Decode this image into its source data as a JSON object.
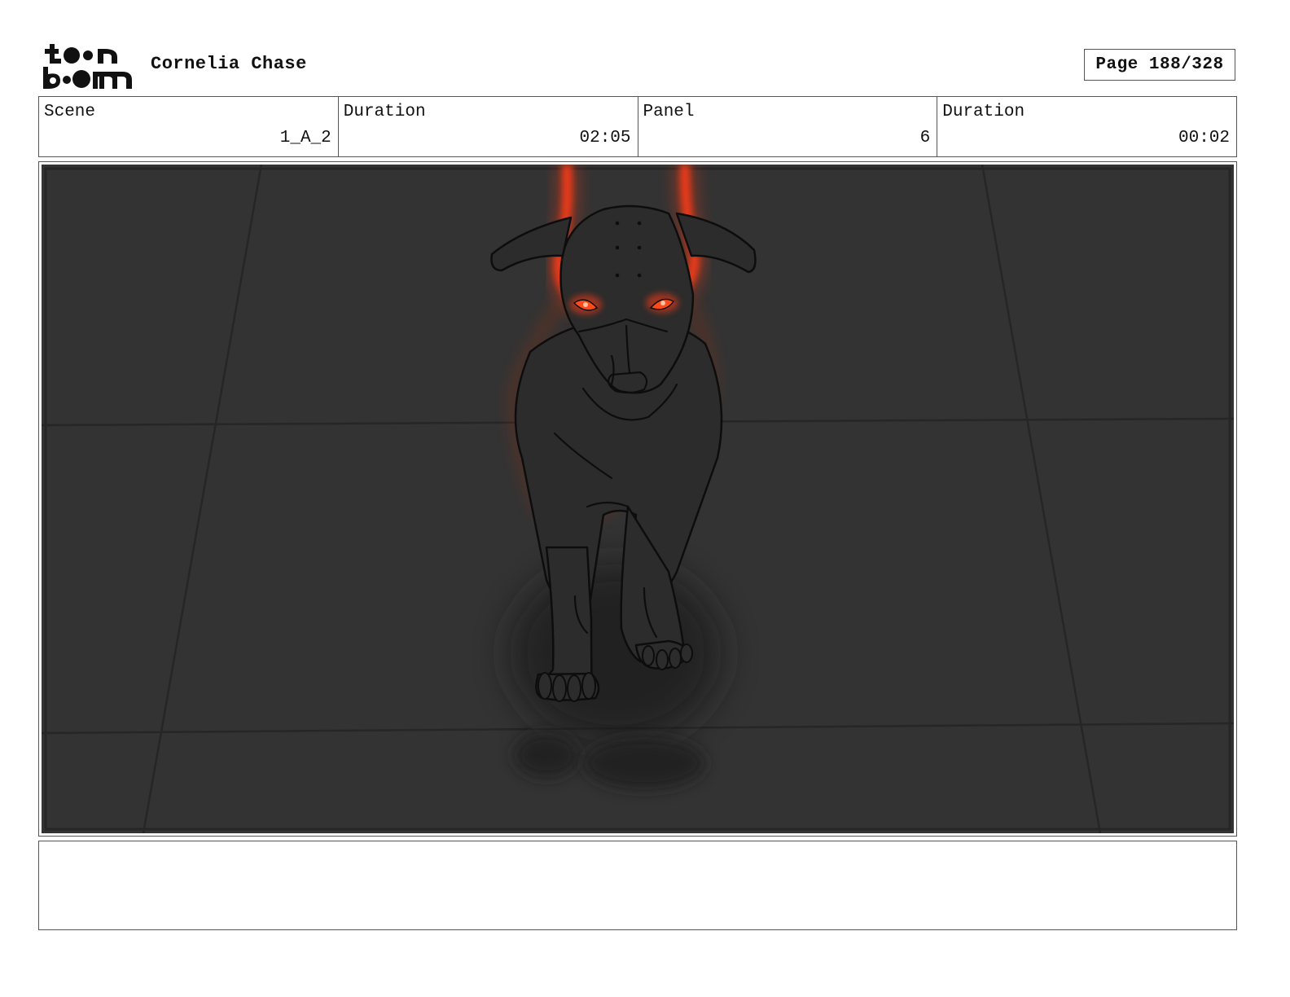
{
  "header": {
    "logo_text_top": "toon",
    "logo_text_bottom": "boom",
    "project_title": "Cornelia Chase",
    "page_label": "Page 188/328"
  },
  "info": {
    "scene_label": "Scene",
    "scene_value": "1_A_2",
    "scene_duration_label": "Duration",
    "scene_duration_value": "02:05",
    "panel_label": "Panel",
    "panel_value": "6",
    "panel_duration_label": "Duration",
    "panel_duration_value": "00:02"
  },
  "panel": {
    "description": "",
    "background_color": "#323232",
    "glow_color": "#ff3a12"
  },
  "notes": {
    "text": ""
  }
}
